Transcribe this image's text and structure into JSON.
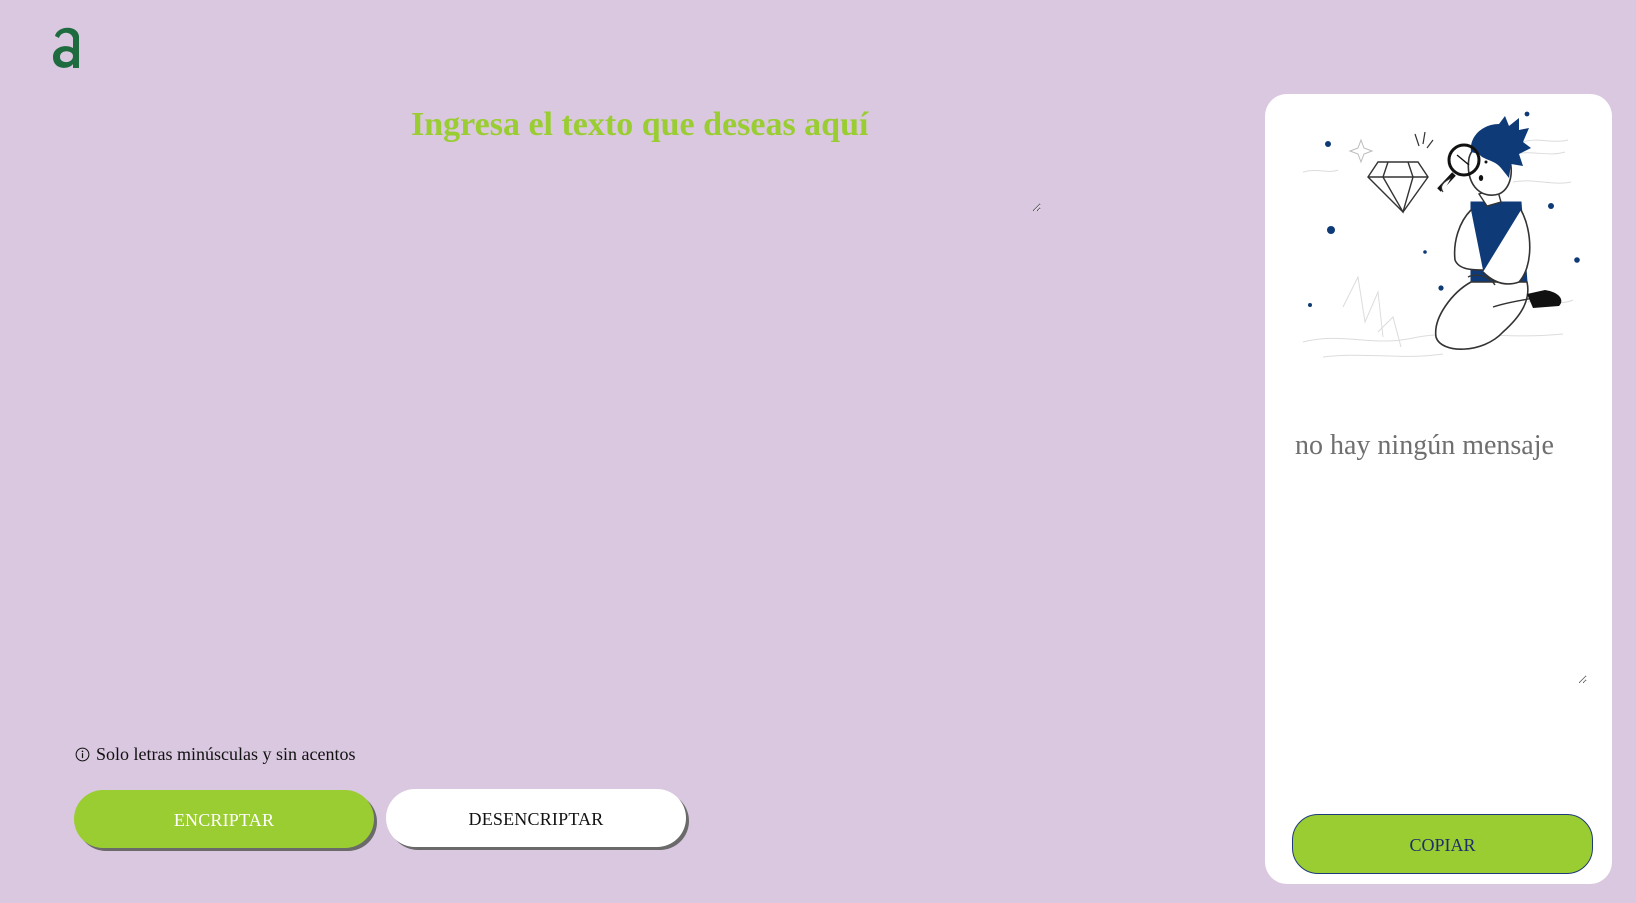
{
  "logo": {
    "letter": "a",
    "color": "#1e6b3f"
  },
  "input": {
    "placeholder": "Ingresa el texto que deseas aquí",
    "value": ""
  },
  "hint": {
    "icon": "info-icon",
    "text": "Solo letras minúsculas y sin acentos"
  },
  "buttons": {
    "encrypt_label": "ENCRIPTAR",
    "decrypt_label": "DESENCRIPTAR",
    "copy_label": "COPIAR"
  },
  "output": {
    "placeholder": "no hay ningún mensaje",
    "value": ""
  },
  "illustration": {
    "icon": "person-magnifier-diamond-illustration"
  },
  "colors": {
    "background": "#dac8e0",
    "accent": "#9acd32",
    "panel": "#ffffff",
    "navy": "#0f3a78"
  }
}
